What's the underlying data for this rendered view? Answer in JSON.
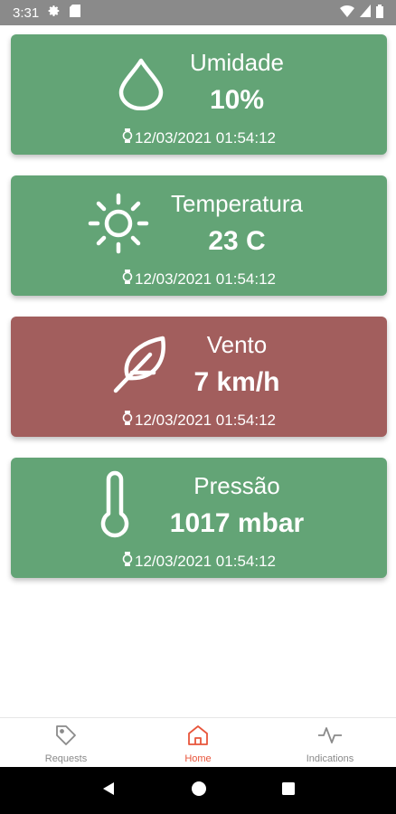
{
  "status_bar": {
    "time": "3:31",
    "icons": [
      "gear-icon",
      "sd-card-icon",
      "wifi-icon",
      "signal-icon",
      "battery-icon"
    ]
  },
  "colors": {
    "green_card": "#63a476",
    "red_card": "#a25e5d",
    "active_tab": "#e8553b",
    "inactive_tab": "#8a8a8a"
  },
  "cards": [
    {
      "title": "Umidade",
      "value": "10%",
      "timestamp": "12/03/2021 01:54:12",
      "icon": "water-drop-icon",
      "status": "green"
    },
    {
      "title": "Temperatura",
      "value": "23 C",
      "timestamp": "12/03/2021 01:54:12",
      "icon": "sun-icon",
      "status": "green"
    },
    {
      "title": "Vento",
      "value": "7 km/h",
      "timestamp": "12/03/2021 01:54:12",
      "icon": "feather-icon",
      "status": "red"
    },
    {
      "title": "Pressão",
      "value": "1017 mbar",
      "timestamp": "12/03/2021 01:54:12",
      "icon": "thermometer-icon",
      "status": "green"
    }
  ],
  "bottom_nav": {
    "items": [
      {
        "label": "Requests",
        "icon": "tag-icon",
        "active": false
      },
      {
        "label": "Home",
        "icon": "home-icon",
        "active": true
      },
      {
        "label": "Indications",
        "icon": "activity-icon",
        "active": false
      }
    ]
  },
  "system_nav": {
    "icons": [
      "back-icon",
      "home-circle-icon",
      "recents-icon"
    ]
  }
}
